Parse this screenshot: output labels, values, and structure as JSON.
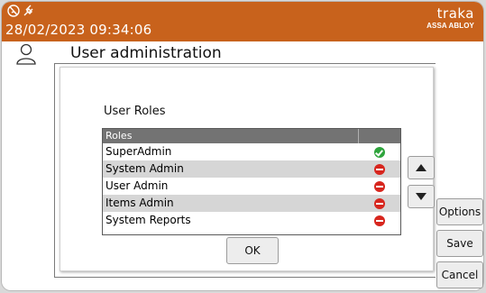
{
  "header": {
    "datetime": "28/02/2023 09:34:06",
    "brand_name": "traka",
    "brand_sub": "ASSA ABLOY",
    "status_icons": [
      "no-network-icon",
      "plug-icon"
    ],
    "bar_color": "#c8621c"
  },
  "page": {
    "title": "User administration",
    "user_icon": "user-icon"
  },
  "dialog": {
    "title": "User Roles",
    "table": {
      "columns": [
        "Roles",
        ""
      ],
      "rows": [
        {
          "role": "SuperAdmin",
          "status": "granted"
        },
        {
          "role": "System Admin",
          "status": "denied"
        },
        {
          "role": "User Admin",
          "status": "denied"
        },
        {
          "role": "Items Admin",
          "status": "denied"
        },
        {
          "role": "System Reports",
          "status": "denied"
        }
      ]
    },
    "move_up_icon": "arrow-up-icon",
    "move_down_icon": "arrow-down-icon",
    "ok_label": "OK"
  },
  "side_buttons": {
    "options_label": "Options",
    "save_label": "Save",
    "cancel_label": "Cancel"
  },
  "colors": {
    "granted": "#2ea43c",
    "denied": "#d7261e",
    "table_header": "#737373",
    "row_alt": "#d6d6d6"
  }
}
